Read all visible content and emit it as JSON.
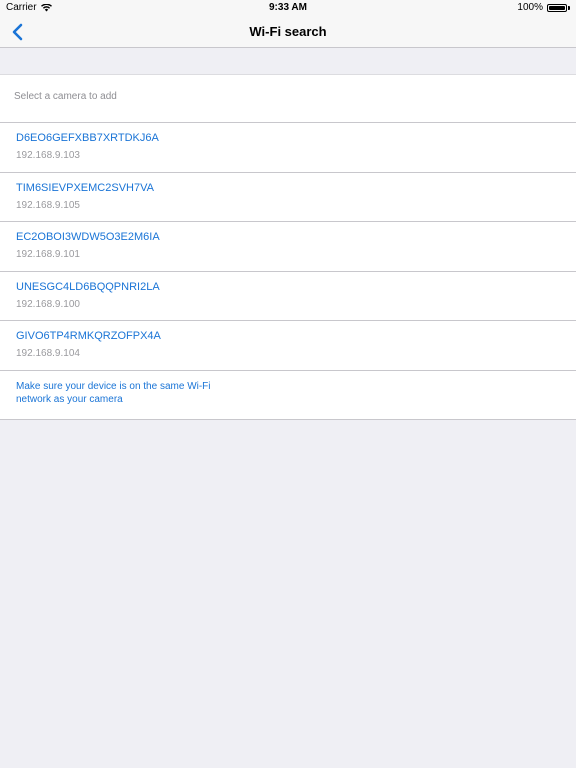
{
  "status_bar": {
    "carrier": "Carrier",
    "time": "9:33 AM",
    "battery": "100%",
    "battery_level": 1.0,
    "icons": [
      "wifi-icon",
      "battery-icon"
    ]
  },
  "nav": {
    "title": "Wi-Fi search",
    "back_icon": "chevron-left-icon"
  },
  "section_header": "Select a camera to add",
  "cameras": [
    {
      "name": "D6EO6GEFXBB7XRTDKJ6A",
      "ip": "192.168.9.103"
    },
    {
      "name": "TIM6SIEVPXEMC2SVH7VA",
      "ip": "192.168.9.105"
    },
    {
      "name": "EC2OBOI3WDW5O3E2M6IA",
      "ip": "192.168.9.101"
    },
    {
      "name": "UNESGC4LD6BQQPNRI2LA",
      "ip": "192.168.9.100"
    },
    {
      "name": "GIVO6TP4RMKQRZOFPX4A",
      "ip": "192.168.9.104"
    }
  ],
  "hint": "Make sure your device is on the same Wi-Fi network as your camera",
  "colors": {
    "accent": "#1a74d6",
    "background": "#efeff4",
    "secondary_text": "#9a9a9e"
  }
}
